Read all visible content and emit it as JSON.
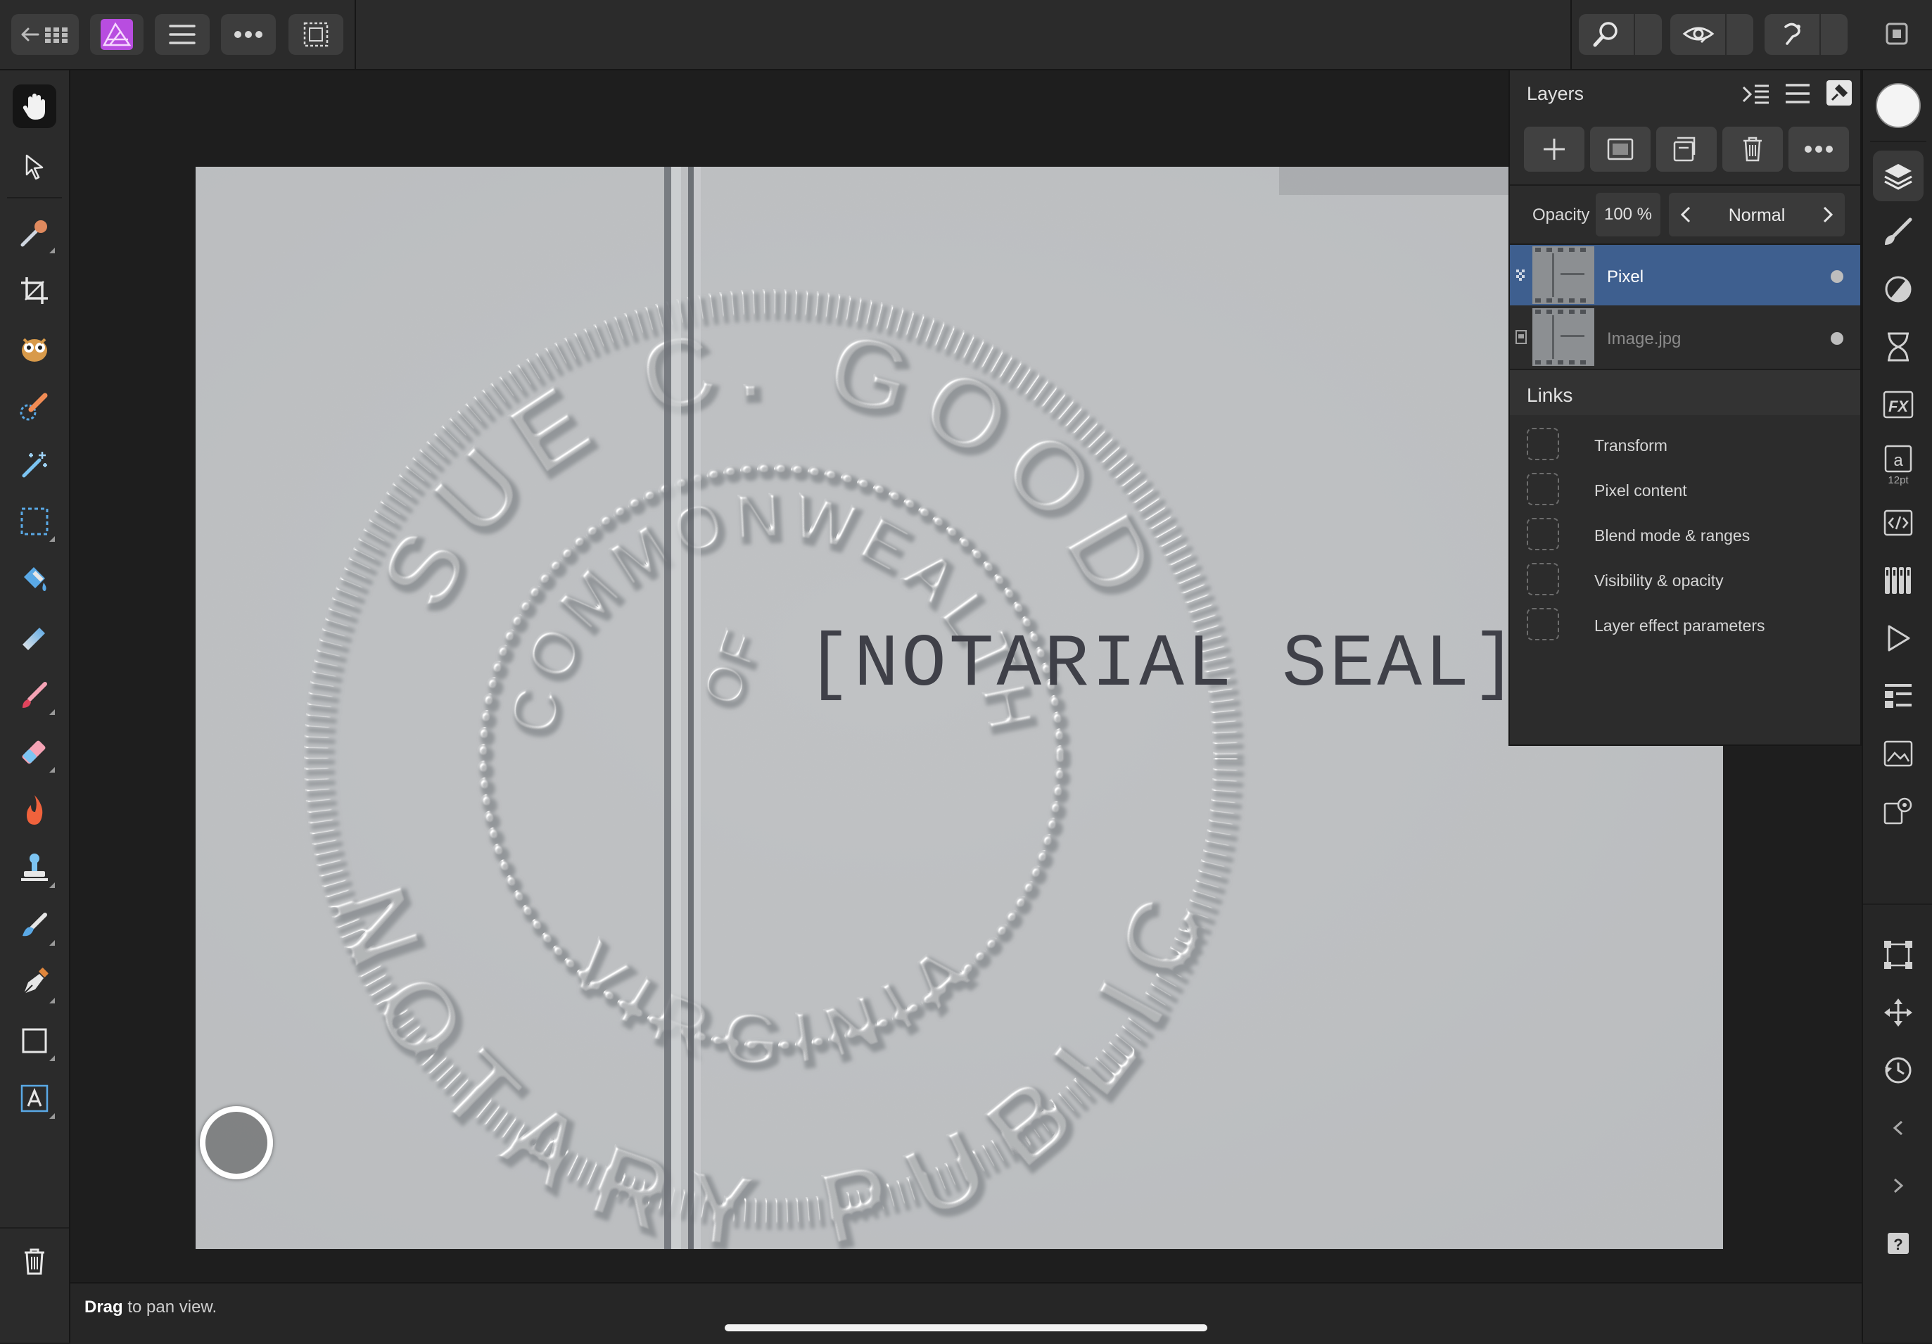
{
  "layers_panel": {
    "title": "Layers",
    "opacity_label": "Opacity",
    "opacity_value": "100 %",
    "blend_mode": "Normal",
    "layers": [
      {
        "name": "Pixel",
        "selected": true
      },
      {
        "name": "Image.jpg",
        "selected": false
      }
    ],
    "links_title": "Links",
    "links": [
      "Transform",
      "Pixel content",
      "Blend mode & ranges",
      "Visibility & opacity",
      "Layer effect parameters"
    ]
  },
  "document": {
    "typed_text": "[NOTARIAL SEAL]",
    "seal_outer_top": "SUE C. GOOD",
    "seal_outer_bottom": "NOTARY PUBLIC",
    "seal_inner_top": "COMMONWEALTH",
    "seal_inner_mid": "OF",
    "seal_inner_bottom": "VIRGINIA"
  },
  "studio": {
    "character_size": "12pt"
  },
  "status": {
    "action": "Drag",
    "rest": " to pan view."
  },
  "colors": {
    "accent_selected_row": "#3e5f8f",
    "panel_bg": "#2c2c2c",
    "toolbar_bg": "#2b2b2b",
    "app_icon": "#b84de0"
  }
}
